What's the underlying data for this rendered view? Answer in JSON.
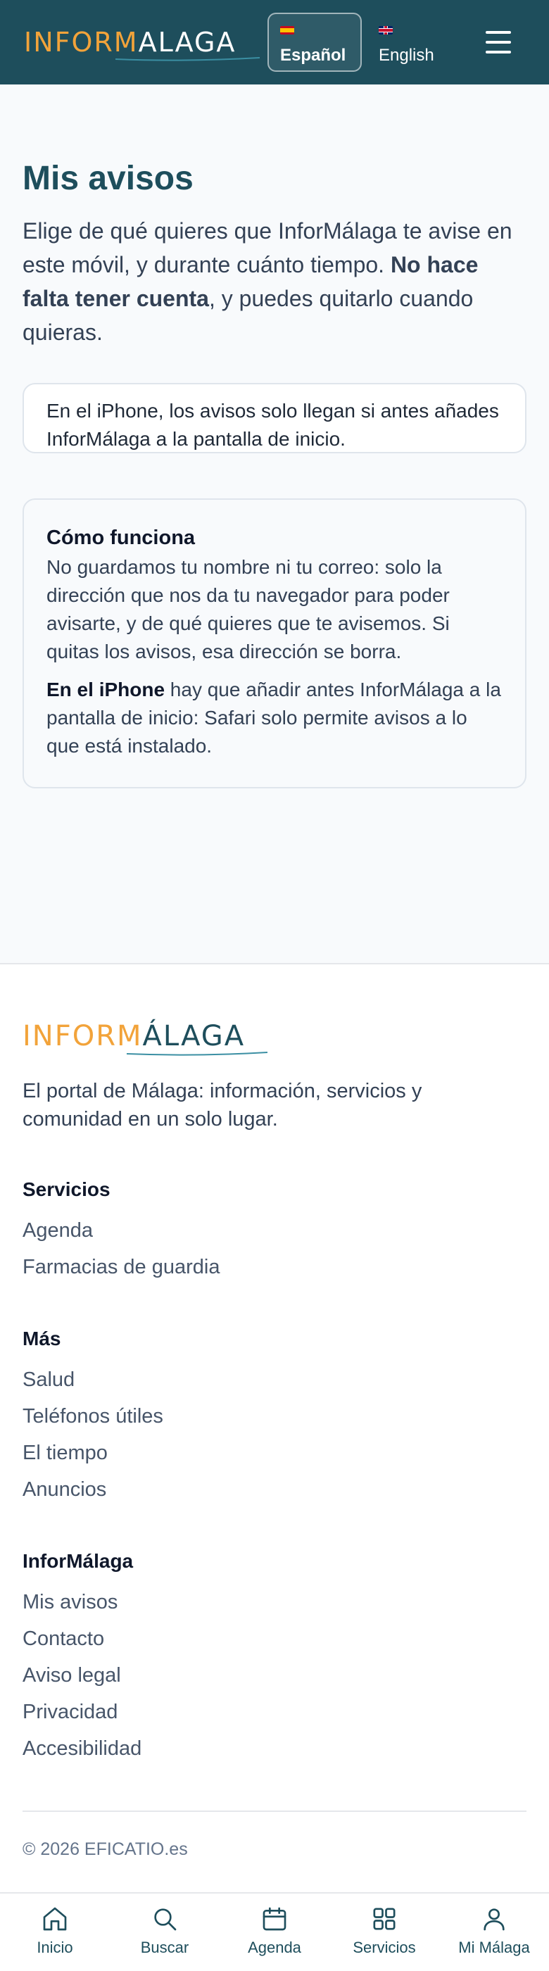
{
  "header": {
    "logo_inform": "INFORM",
    "logo_malaga": "ALAGA",
    "lang_es_flag": "es-flag",
    "lang_es_label": "Español",
    "lang_en_flag": "uk-flag",
    "lang_en_label": "English",
    "menu_icon": "hamburger-menu-icon"
  },
  "main": {
    "title": "Mis avisos",
    "intro_part1": "Elige de qué quieres que InforMálaga te avise en este móvil, y durante cuánto tiempo. ",
    "intro_bold": "No hace falta tener cuenta",
    "intro_part2": ", y puedes quitarlo cuando quieras.",
    "iphone_notice": "En el iPhone, los avisos solo llegan si antes añades InforMálaga a la pantalla de inicio.",
    "how_title": "Cómo funciona",
    "how_p1": "No guardamos tu nombre ni tu correo: solo la dirección que nos da tu navegador para poder avisarte, y de qué quieres que te avisemos. Si quitas los avisos, esa dirección se borra.",
    "how_p2_bold": "En el iPhone",
    "how_p2_rest": " hay que añadir antes InforMálaga a la pantalla de inicio: Safari solo permite avisos a lo que está instalado."
  },
  "footer": {
    "logo_inform": "INFORM",
    "logo_malaga": "ÁLAGA",
    "tagline": "El portal de Málaga: información, servicios y comunidad en un solo lugar.",
    "sections": [
      {
        "heading": "Servicios",
        "links": [
          "Agenda",
          "Farmacias de guardia"
        ]
      },
      {
        "heading": "Más",
        "links": [
          "Salud",
          "Teléfonos útiles",
          "El tiempo",
          "Anuncios"
        ]
      },
      {
        "heading": "InforMálaga",
        "links": [
          "Mis avisos",
          "Contacto",
          "Aviso legal",
          "Privacidad",
          "Accesibilidad"
        ]
      }
    ],
    "copyright": "© 2026 EFICATIO.es"
  },
  "bottom_nav": [
    {
      "label": "Inicio",
      "icon": "home-icon"
    },
    {
      "label": "Buscar",
      "icon": "search-icon"
    },
    {
      "label": "Agenda",
      "icon": "calendar-icon"
    },
    {
      "label": "Servicios",
      "icon": "grid-icon"
    },
    {
      "label": "Mi Málaga",
      "icon": "user-icon"
    }
  ],
  "colors": {
    "header_bg": "#1e4e5c",
    "logo_orange": "#f2a33a",
    "accent_teal": "#1e4e5c",
    "page_bg": "#f8fafc"
  }
}
